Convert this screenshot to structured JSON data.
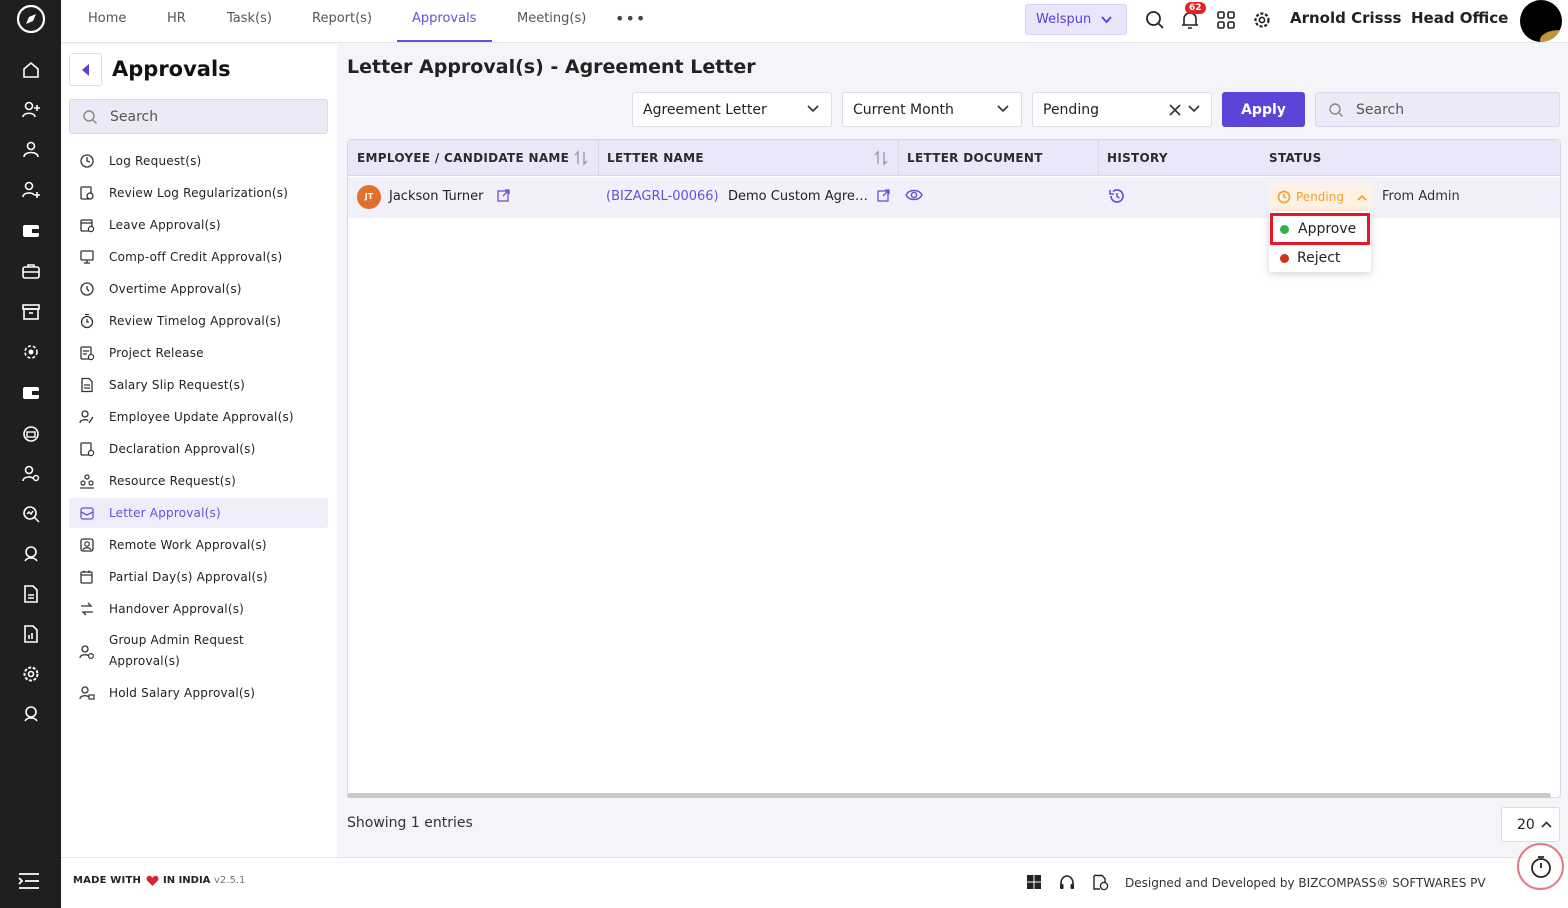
{
  "topnav": {
    "items": [
      "Home",
      "HR",
      "Task(s)",
      "Report(s)",
      "Approvals",
      "Meeting(s)"
    ],
    "active": "Approvals",
    "more": "•••",
    "org_selector": "Welspun",
    "notification_count": "62",
    "user_name": "Arnold Crisss",
    "office": "Head Office"
  },
  "sidebar": {
    "title": "Approvals",
    "search_placeholder": "Search",
    "items": [
      {
        "label": "Log Request(s)",
        "icon": "log-icon"
      },
      {
        "label": "Review Log Regularization(s)",
        "icon": "review-log-icon"
      },
      {
        "label": "Leave Approval(s)",
        "icon": "leave-icon"
      },
      {
        "label": "Comp-off Credit Approval(s)",
        "icon": "comp-off-icon"
      },
      {
        "label": "Overtime Approval(s)",
        "icon": "overtime-icon"
      },
      {
        "label": "Review Timelog Approval(s)",
        "icon": "timelog-icon"
      },
      {
        "label": "Project Release",
        "icon": "project-icon"
      },
      {
        "label": "Salary Slip Request(s)",
        "icon": "salary-slip-icon"
      },
      {
        "label": "Employee Update Approval(s)",
        "icon": "employee-update-icon"
      },
      {
        "label": "Declaration Approval(s)",
        "icon": "declaration-icon"
      },
      {
        "label": "Resource Request(s)",
        "icon": "resource-icon"
      },
      {
        "label": "Letter Approval(s)",
        "icon": "letter-icon",
        "active": true
      },
      {
        "label": "Remote Work Approval(s)",
        "icon": "remote-work-icon"
      },
      {
        "label": "Partial Day(s) Approval(s)",
        "icon": "partial-day-icon"
      },
      {
        "label": "Handover Approval(s)",
        "icon": "handover-icon"
      },
      {
        "label": "Group Admin Request Approval(s)",
        "icon": "group-admin-icon"
      },
      {
        "label": "Hold Salary Approval(s)",
        "icon": "hold-salary-icon"
      }
    ]
  },
  "main": {
    "title": "Letter Approval(s) - Agreement Letter",
    "filters": {
      "letter_type": "Agreement Letter",
      "period": "Current Month",
      "status": "Pending",
      "apply_label": "Apply",
      "search_placeholder": "Search"
    },
    "table": {
      "columns": [
        "EMPLOYEE / CANDIDATE NAME",
        "LETTER NAME",
        "LETTER DOCUMENT",
        "HISTORY",
        "STATUS"
      ],
      "rows": [
        {
          "initials": "JT",
          "employee": "Jackson Turner",
          "letter_code": "(BIZAGRL-00066)",
          "letter_name": "Demo Custom Agreement Letter",
          "status": "Pending",
          "from": "From Admin"
        }
      ]
    },
    "status_menu": {
      "options": [
        {
          "label": "Approve",
          "color": "#2eb34a"
        },
        {
          "label": "Reject",
          "color": "#d0341e"
        }
      ]
    },
    "showing": "Showing 1 entries",
    "page_size": "20"
  },
  "footer": {
    "made_with": "MADE WITH",
    "in_india": "IN INDIA",
    "version": "v2.5.1",
    "credit": "Designed and Developed by  BIZCOMPASS® SOFTWARES PV"
  },
  "colors": {
    "accent": "#5b45d6",
    "rail": "#1f1f1f",
    "pending": "#f0a030",
    "highlight": "#e01a2a"
  }
}
